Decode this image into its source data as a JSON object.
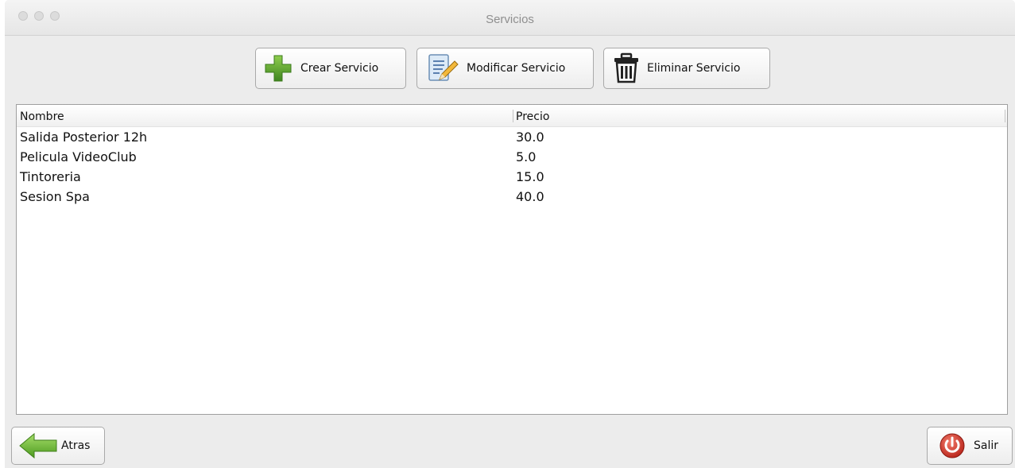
{
  "window": {
    "title": "Servicios"
  },
  "toolbar": {
    "create_label": "Crear Servicio",
    "modify_label": "Modificar Servicio",
    "delete_label": "Eliminar Servicio"
  },
  "table": {
    "columns": [
      "Nombre",
      "Precio"
    ],
    "rows": [
      {
        "nombre": "Salida Posterior 12h",
        "precio": "30.0"
      },
      {
        "nombre": "Pelicula VideoClub",
        "precio": "5.0"
      },
      {
        "nombre": "Tintoreria",
        "precio": "15.0"
      },
      {
        "nombre": "Sesion Spa",
        "precio": "40.0"
      }
    ]
  },
  "footer": {
    "back_label": "Atras",
    "exit_label": "Salir"
  },
  "icons": {
    "create": "plus-icon",
    "modify": "edit-document-icon",
    "delete": "trash-icon",
    "back": "arrow-left-icon",
    "exit": "power-icon"
  },
  "colors": {
    "plus_green": "#4f9a2a",
    "arrow_green": "#5fb32c",
    "power_red": "#d23a2a"
  }
}
